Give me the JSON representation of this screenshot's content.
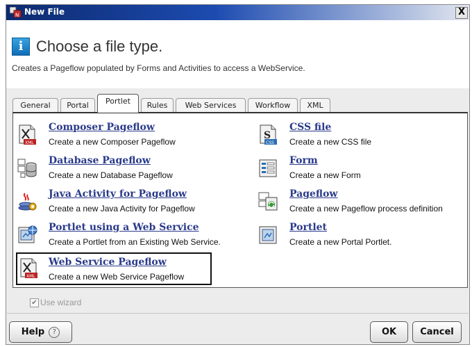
{
  "window": {
    "title": "New File",
    "close_glyph": "X"
  },
  "header": {
    "info_glyph": "i",
    "title": "Choose a file type.",
    "description": "Creates a Pageflow populated by Forms and Activities to access a WebService."
  },
  "tabs": [
    {
      "label": "General",
      "active": false
    },
    {
      "label": "Portal",
      "active": false
    },
    {
      "label": "Portlet",
      "active": true
    },
    {
      "label": "Rules",
      "active": false
    },
    {
      "label": "Web Services",
      "active": false
    },
    {
      "label": "Workflow",
      "active": false
    },
    {
      "label": "XML",
      "active": false
    }
  ],
  "file_types": [
    {
      "name": "Composer Pageflow",
      "description": "Create a new Composer Pageflow",
      "icon": "xml-document-icon",
      "selected": false
    },
    {
      "name": "CSS file",
      "description": "Create a new CSS file",
      "icon": "css-file-icon",
      "selected": false
    },
    {
      "name": "Database Pageflow",
      "description": "Create a new Database Pageflow",
      "icon": "database-icon",
      "selected": false
    },
    {
      "name": "Form",
      "description": "Create a new Form",
      "icon": "form-icon",
      "selected": false
    },
    {
      "name": "Java Activity for Pageflow",
      "description": "Create a new Java Activity for Pageflow",
      "icon": "java-activity-icon",
      "selected": false
    },
    {
      "name": "Pageflow",
      "description": "Create a new Pageflow process definition",
      "icon": "pageflow-icon",
      "selected": false
    },
    {
      "name": "Portlet using a Web Service",
      "description": "Create a Portlet from an Existing Web Service.",
      "icon": "portlet-webservice-icon",
      "selected": false
    },
    {
      "name": "Portlet",
      "description": "Create a new Portal Portlet.",
      "icon": "portlet-icon",
      "selected": false
    },
    {
      "name": "Web Service Pageflow",
      "description": "Create a new Web Service Pageflow",
      "icon": "xml-document-icon",
      "selected": true
    }
  ],
  "use_wizard": {
    "label": "Use wizard",
    "checked": true,
    "enabled": false
  },
  "buttons": {
    "help": "Help",
    "help_glyph": "?",
    "ok": "OK",
    "cancel": "Cancel"
  },
  "colors": {
    "link": "#2a3a8a",
    "titlebar": "#1c4bb0",
    "selection_border": "#111111"
  }
}
